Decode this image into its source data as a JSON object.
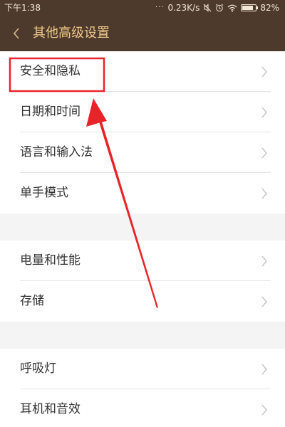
{
  "status_bar": {
    "time": "下午1:38",
    "network_speed": "0.23K/s",
    "battery_percent": "82%",
    "battery_level": 0.82,
    "icons": [
      "signal-dots-icon",
      "mute-icon",
      "alarm-icon",
      "wifi-icon",
      "battery-icon"
    ]
  },
  "header": {
    "back_icon": "chevron-left-icon",
    "title": "其他高级设置"
  },
  "sections": [
    {
      "items": [
        {
          "label": "安全和隐私",
          "icon": "chevron-right-icon",
          "highlighted": true
        },
        {
          "label": "日期和时间",
          "icon": "chevron-right-icon"
        },
        {
          "label": "语言和输入法",
          "icon": "chevron-right-icon"
        },
        {
          "label": "单手模式",
          "icon": "chevron-right-icon"
        }
      ]
    },
    {
      "items": [
        {
          "label": "电量和性能",
          "icon": "chevron-right-icon"
        },
        {
          "label": "存储",
          "icon": "chevron-right-icon"
        }
      ]
    },
    {
      "items": [
        {
          "label": "呼吸灯",
          "icon": "chevron-right-icon"
        },
        {
          "label": "耳机和音效",
          "icon": "chevron-right-icon"
        }
      ]
    }
  ],
  "colors": {
    "header_background": "#4e3a2c",
    "title_text": "#f0c98c",
    "annotation_red": "#e8242b",
    "chevron": "#c4c4c4"
  }
}
